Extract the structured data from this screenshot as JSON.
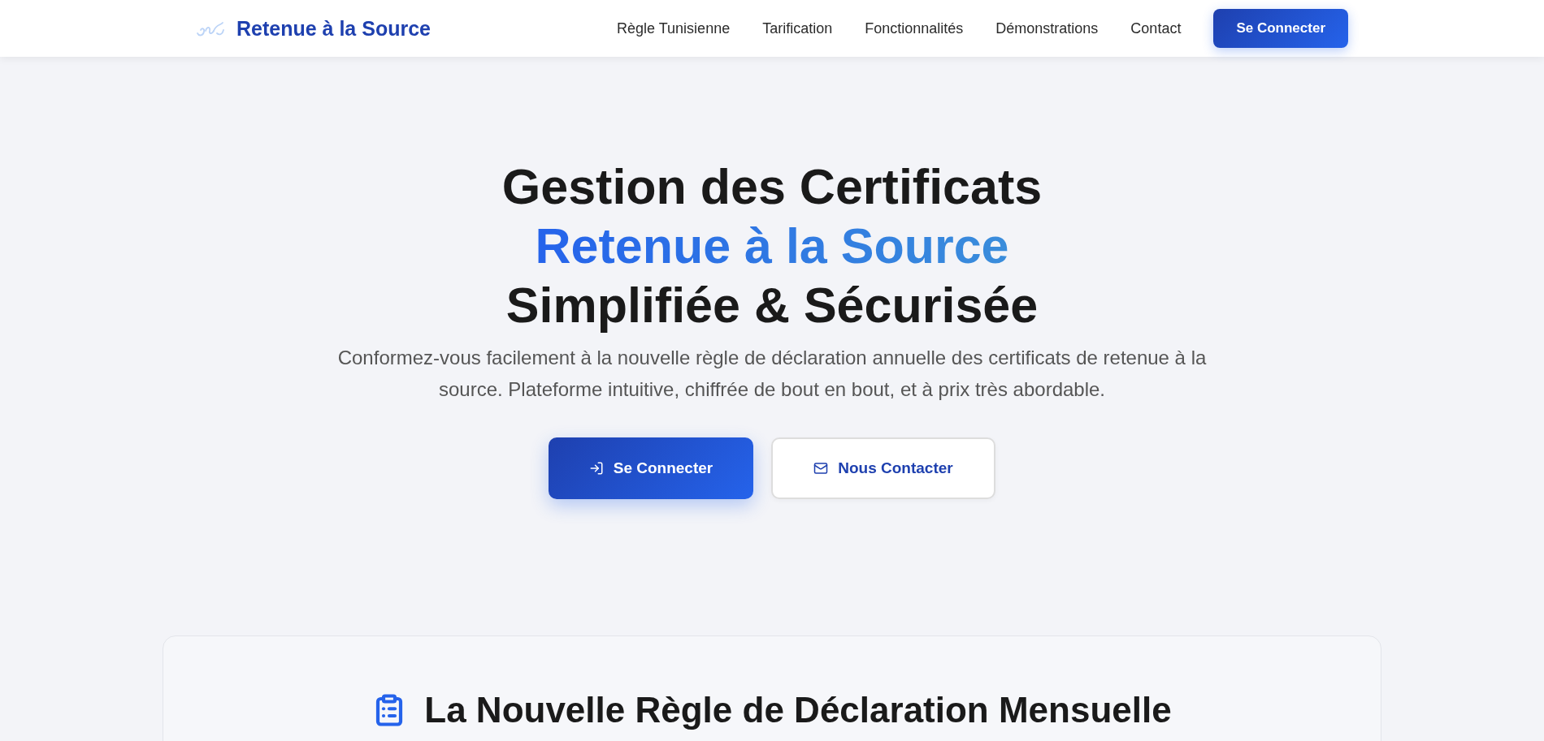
{
  "header": {
    "brand": "Retenue à la Source",
    "nav_links": [
      "Règle Tunisienne",
      "Tarification",
      "Fonctionnalités",
      "Démonstrations",
      "Contact"
    ],
    "login_button": "Se Connecter"
  },
  "hero": {
    "title_lines": [
      {
        "text": "Gestion des Certificats",
        "kind": "plain"
      },
      {
        "text": "Retenue à la Source",
        "kind": "highlight"
      },
      {
        "text": "Simplifiée & Sécurisée",
        "kind": "plain"
      }
    ],
    "subtitle": "Conformez-vous facilement à la nouvelle règle de déclaration annuelle des certificats de retenue à la source. Plateforme intuitive, chiffrée de bout en bout, et à prix très abordable.",
    "buttons": [
      {
        "label": "Se Connecter",
        "kind": "primary"
      },
      {
        "label": "Nous Contacter",
        "kind": "secondary"
      }
    ]
  },
  "rule_section": {
    "heading": "La Nouvelle Règle de Déclaration Mensuelle"
  }
}
